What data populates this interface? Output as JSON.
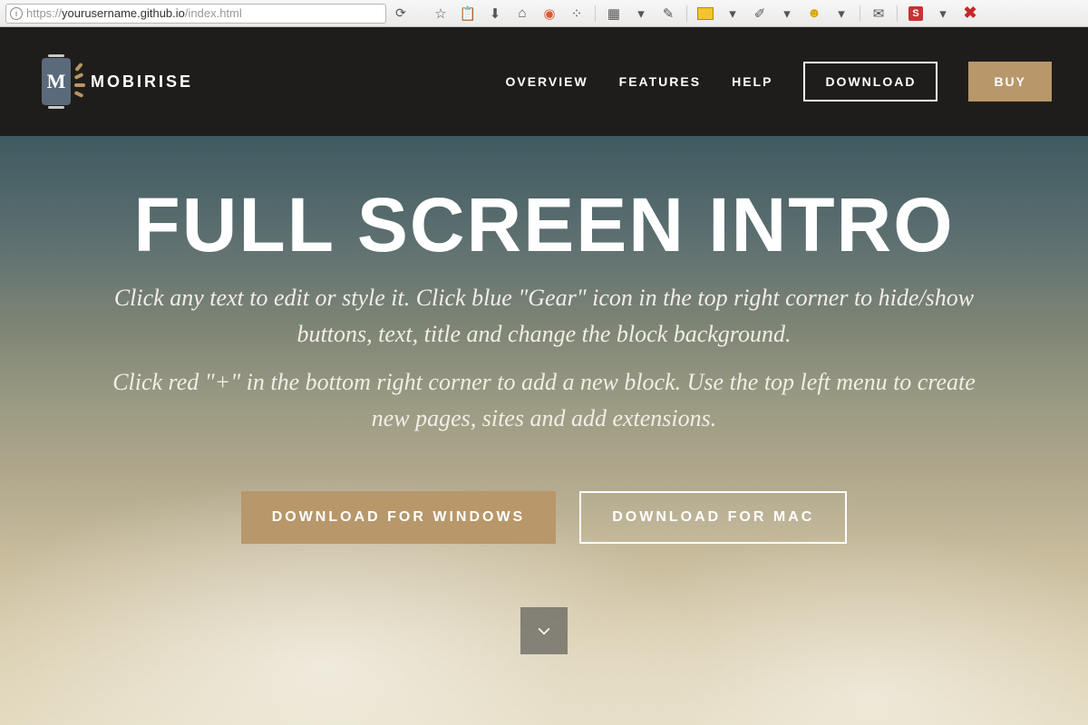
{
  "browser": {
    "url_prefix": "https://",
    "url_main": "yourusername.github.io",
    "url_suffix": "/index.html"
  },
  "header": {
    "brand": "MOBIRISE",
    "nav": {
      "overview": "OVERVIEW",
      "features": "FEATURES",
      "help": "HELP"
    },
    "download": "DOWNLOAD",
    "buy": "BUY"
  },
  "hero": {
    "title": "FULL SCREEN INTRO",
    "paragraph1": "Click any text to edit or style it. Click blue \"Gear\" icon in the top right corner to hide/show buttons, text, title and change the block background.",
    "paragraph2": "Click red \"+\" in the bottom right corner to add a new block. Use the top left menu to create new pages, sites and add extensions.",
    "btn_windows": "DOWNLOAD FOR WINDOWS",
    "btn_mac": "DOWNLOAD FOR MAC"
  }
}
